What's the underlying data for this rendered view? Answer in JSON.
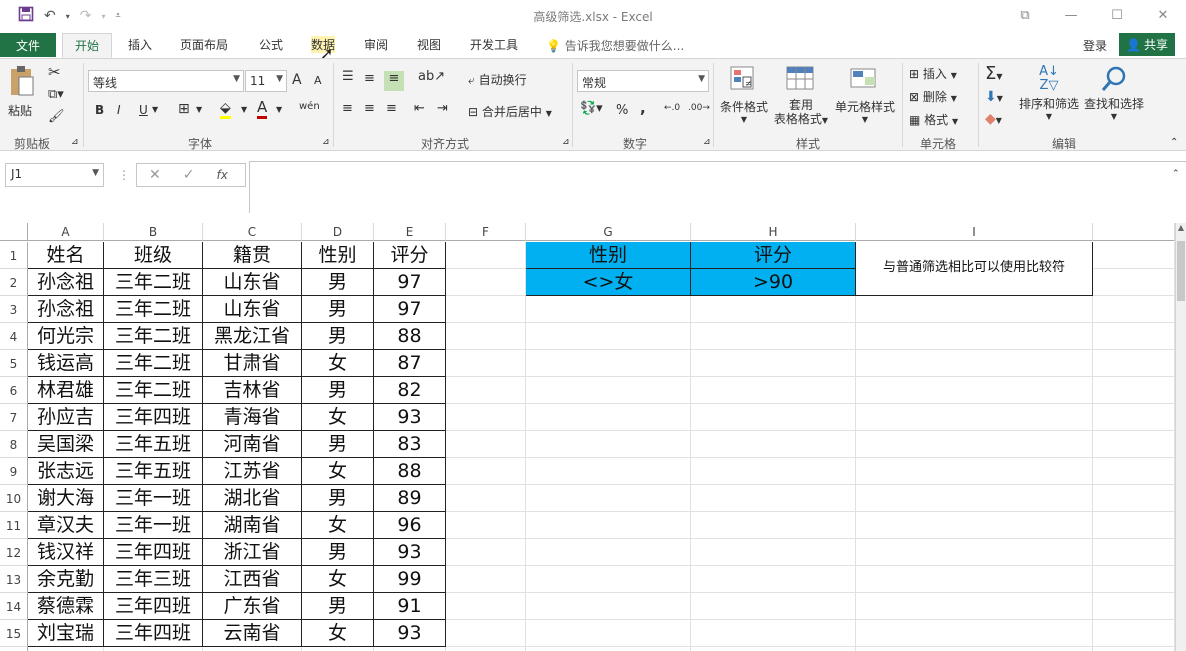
{
  "window": {
    "title": "高级筛选.xlsx - Excel"
  },
  "qat": {
    "save_icon": "save-icon",
    "undo_icon": "undo-icon",
    "redo_icon": "redo-icon"
  },
  "tabs": [
    "文件",
    "开始",
    "插入",
    "页面布局",
    "公式",
    "数据",
    "审阅",
    "视图",
    "开发工具"
  ],
  "tellme": "告诉我您想要做什么...",
  "account": {
    "login": "登录",
    "share": "共享"
  },
  "ribbon": {
    "clipboard": {
      "paste": "粘贴",
      "label": "剪贴板"
    },
    "font": {
      "name": "等线",
      "size": "11",
      "label": "字体",
      "bold": "B",
      "italic": "I",
      "underline": "U",
      "grow": "A",
      "shrink": "A",
      "fontcolor": "A",
      "wen": "wén"
    },
    "alignment": {
      "wrap": "自动换行",
      "merge": "合并后居中",
      "label": "对齐方式"
    },
    "number": {
      "format": "常规",
      "percent": "%",
      "comma": ",",
      "label": "数字"
    },
    "styles": {
      "conditional": "条件格式",
      "table_line1": "套用",
      "table_line2": "表格格式",
      "cell_styles": "单元格样式",
      "label": "样式"
    },
    "cells": {
      "insert": "插入",
      "delete": "删除",
      "format": "格式",
      "label": "单元格"
    },
    "editing": {
      "sort_filter": "排序和筛选",
      "find_select": "查找和选择",
      "label": "编辑"
    }
  },
  "formula_bar": {
    "name_box": "J1",
    "fx": "fx",
    "formula": ""
  },
  "columns": [
    "A",
    "B",
    "C",
    "D",
    "E",
    "F",
    "G",
    "H",
    "I"
  ],
  "rows": [
    [
      "姓名",
      "班级",
      "籍贯",
      "性别",
      "评分"
    ],
    [
      "孙念祖",
      "三年二班",
      "山东省",
      "男",
      "97"
    ],
    [
      "孙念祖",
      "三年二班",
      "山东省",
      "男",
      "97"
    ],
    [
      "何光宗",
      "三年二班",
      "黑龙江省",
      "男",
      "88"
    ],
    [
      "钱运高",
      "三年二班",
      "甘肃省",
      "女",
      "87"
    ],
    [
      "林君雄",
      "三年二班",
      "吉林省",
      "男",
      "82"
    ],
    [
      "孙应吉",
      "三年四班",
      "青海省",
      "女",
      "93"
    ],
    [
      "吴国梁",
      "三年五班",
      "河南省",
      "男",
      "83"
    ],
    [
      "张志远",
      "三年五班",
      "江苏省",
      "女",
      "88"
    ],
    [
      "谢大海",
      "三年一班",
      "湖北省",
      "男",
      "89"
    ],
    [
      "章汉夫",
      "三年一班",
      "湖南省",
      "女",
      "96"
    ],
    [
      "钱汉祥",
      "三年四班",
      "浙江省",
      "男",
      "93"
    ],
    [
      "余克勤",
      "三年三班",
      "江西省",
      "女",
      "99"
    ],
    [
      "蔡德霖",
      "三年四班",
      "广东省",
      "男",
      "91"
    ],
    [
      "刘宝瑞",
      "三年四班",
      "云南省",
      "女",
      "93"
    ]
  ],
  "criteria": {
    "headers": [
      "性别",
      "评分"
    ],
    "values": [
      "<>女",
      ">90"
    ],
    "note": "与普通筛选相比可以使用比较符"
  },
  "colors": {
    "excel_green": "#217346",
    "criteria_blue": "#00b0f0"
  }
}
